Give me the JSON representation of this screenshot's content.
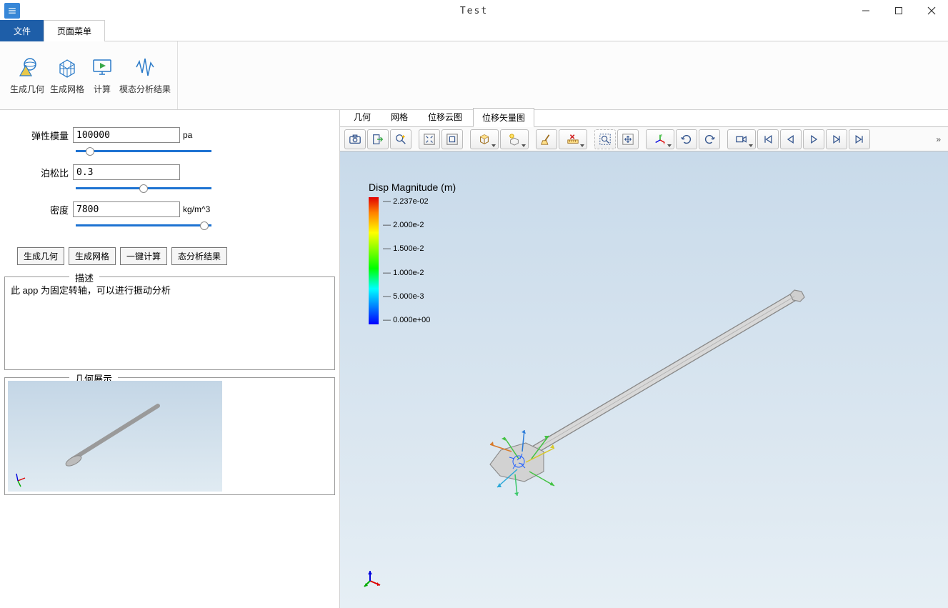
{
  "window": {
    "title": "Test"
  },
  "tabs": {
    "file": "文件",
    "page_menu": "页面菜单"
  },
  "ribbon": {
    "gen_geom": "生成几何",
    "gen_mesh": "生成网格",
    "compute": "计算",
    "modal_result": "模态分析结果"
  },
  "params": {
    "elastic_label": "弹性模量",
    "elastic_value": "100000",
    "elastic_unit": "pa",
    "poisson_label": "泊松比",
    "poisson_value": "0.3",
    "density_label": "密度",
    "density_value": "7800",
    "density_unit": "kg/m^3"
  },
  "buttons": {
    "gen_geom": "生成几何",
    "gen_mesh": "生成网格",
    "one_click": "一键计算",
    "modal_result": "态分析结果"
  },
  "desc_title": "描述",
  "desc_text": "此 app 为固定转轴，可以进行振动分析",
  "geom_title": "几何展示",
  "view_tabs": {
    "geom": "几何",
    "mesh": "网格",
    "disp_cloud": "位移云图",
    "disp_vector": "位移矢量图"
  },
  "colorbar": {
    "title": "Disp Magnitude (m)",
    "ticks": [
      "2.237e-02",
      "2.000e-2",
      "1.500e-2",
      "1.000e-2",
      "5.000e-3",
      "0.000e+00"
    ]
  },
  "toolbar_overflow": "»"
}
